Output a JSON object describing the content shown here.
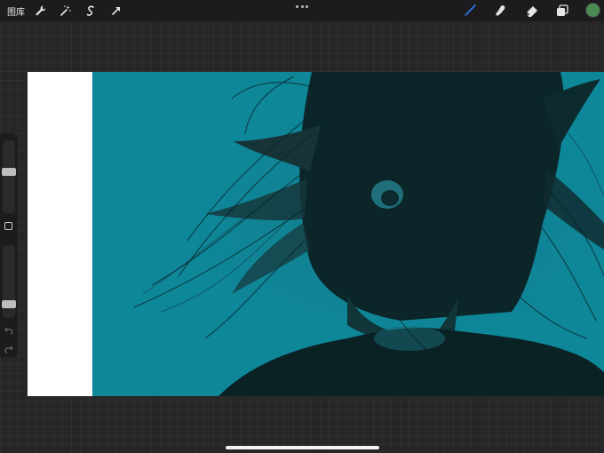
{
  "topbar": {
    "gallery_label": "图库",
    "left_tools": [
      {
        "name": "wrench-icon"
      },
      {
        "name": "magic-wand-icon"
      },
      {
        "name": "selection-s-icon"
      },
      {
        "name": "transform-arrow-icon"
      }
    ],
    "right_tools": [
      {
        "name": "brush-icon",
        "active_color": "#3478f6"
      },
      {
        "name": "smudge-icon"
      },
      {
        "name": "eraser-icon"
      },
      {
        "name": "layers-icon"
      }
    ],
    "current_color": "#4a8a52"
  },
  "canvas": {
    "background_color": "#0e8799",
    "left_strip_color": "#ffffff",
    "figure_color": "#0a2226"
  },
  "sidebar": {
    "brush_size_level": 0.58,
    "opacity_level": 0.85
  }
}
